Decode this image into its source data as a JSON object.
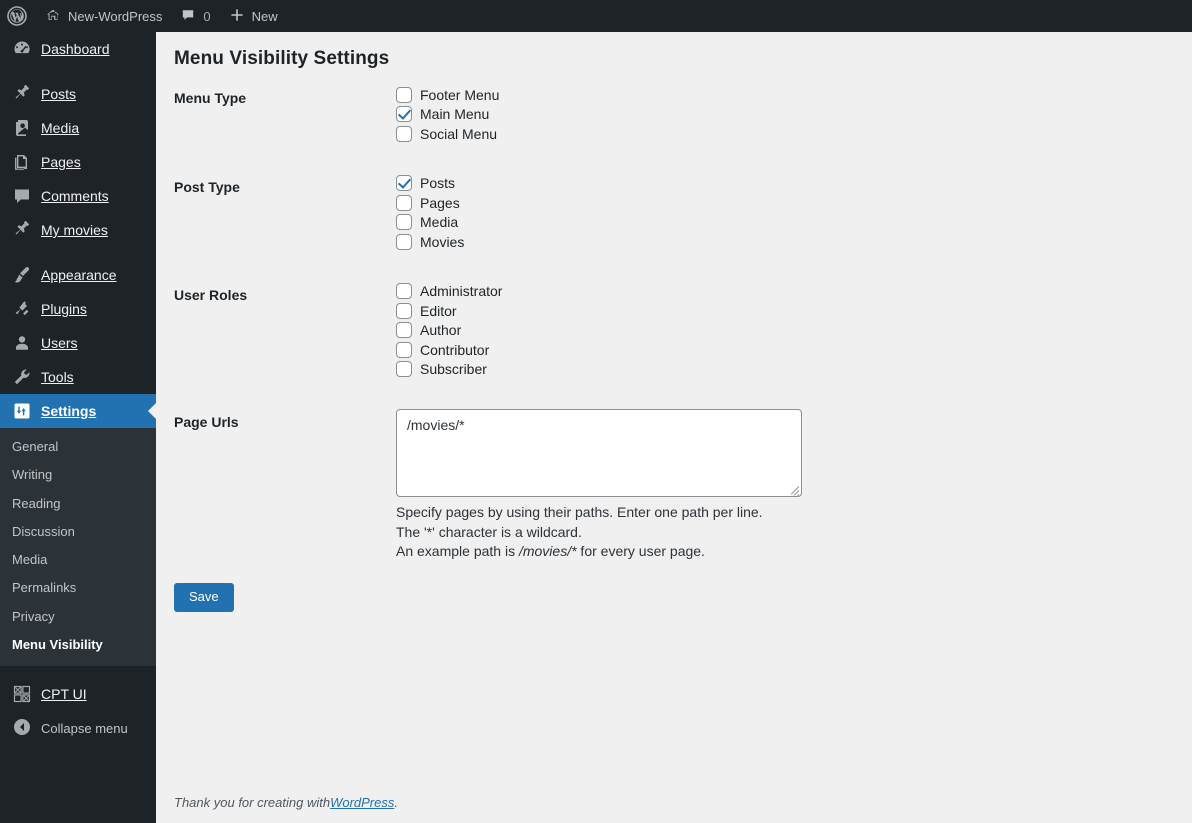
{
  "adminbar": {
    "logo_icon": "wordpress-logo-icon",
    "site": {
      "icon": "home-icon",
      "label": "New-WordPress"
    },
    "comments": {
      "icon": "comment-bubble-icon",
      "count": "0"
    },
    "new": {
      "icon": "plus-icon",
      "label": "New"
    }
  },
  "sidebar": {
    "items": [
      {
        "label": "Dashboard",
        "icon": "dashboard-icon",
        "current": false,
        "separator_before": false
      },
      {
        "label": "Posts",
        "icon": "pin-icon",
        "current": false,
        "separator_before": true
      },
      {
        "label": "Media",
        "icon": "media-icon",
        "current": false,
        "separator_before": false
      },
      {
        "label": "Pages",
        "icon": "pages-icon",
        "current": false,
        "separator_before": false
      },
      {
        "label": "Comments",
        "icon": "comment-bubble-icon",
        "current": false,
        "separator_before": false
      },
      {
        "label": "My movies",
        "icon": "pin-icon",
        "current": false,
        "separator_before": false
      },
      {
        "label": "Appearance",
        "icon": "paintbrush-icon",
        "current": false,
        "separator_before": true
      },
      {
        "label": "Plugins",
        "icon": "plug-icon",
        "current": false,
        "separator_before": false
      },
      {
        "label": "Users",
        "icon": "user-icon",
        "current": false,
        "separator_before": false
      },
      {
        "label": "Tools",
        "icon": "wrench-icon",
        "current": false,
        "separator_before": false
      },
      {
        "label": "Settings",
        "icon": "settings-sliders-icon",
        "current": true,
        "separator_before": false
      }
    ],
    "submenu": [
      {
        "label": "General",
        "current": false
      },
      {
        "label": "Writing",
        "current": false
      },
      {
        "label": "Reading",
        "current": false
      },
      {
        "label": "Discussion",
        "current": false
      },
      {
        "label": "Media",
        "current": false
      },
      {
        "label": "Permalinks",
        "current": false
      },
      {
        "label": "Privacy",
        "current": false
      },
      {
        "label": "Menu Visibility",
        "current": true
      }
    ],
    "after_items": [
      {
        "label": "CPT UI",
        "icon": "cpt-ui-grid-icon",
        "current": false,
        "separator_before": true
      }
    ],
    "collapse": {
      "label": "Collapse menu",
      "icon": "collapse-arrow-icon"
    }
  },
  "page": {
    "title": "Menu Visibility Settings"
  },
  "form": {
    "fields": [
      {
        "label": "Menu Type",
        "name": "menu-type",
        "options": [
          {
            "label": "Footer Menu",
            "checked": false
          },
          {
            "label": "Main Menu",
            "checked": true
          },
          {
            "label": "Social Menu",
            "checked": false
          }
        ]
      },
      {
        "label": "Post Type",
        "name": "post-type",
        "options": [
          {
            "label": "Posts",
            "checked": true
          },
          {
            "label": "Pages",
            "checked": false
          },
          {
            "label": "Media",
            "checked": false
          },
          {
            "label": "Movies",
            "checked": false
          }
        ]
      },
      {
        "label": "User Roles",
        "name": "user-roles",
        "options": [
          {
            "label": "Administrator",
            "checked": false
          },
          {
            "label": "Editor",
            "checked": false
          },
          {
            "label": "Author",
            "checked": false
          },
          {
            "label": "Contributor",
            "checked": false
          },
          {
            "label": "Subscriber",
            "checked": false
          }
        ]
      }
    ],
    "page_urls": {
      "label": "Page Urls",
      "value": "/movies/*",
      "placeholder": "",
      "hint_line1": "Specify pages by using their paths. Enter one path per line.",
      "hint_line2": "The '*' character is a wildcard.",
      "hint_line3_prefix": "An example path is ",
      "hint_line3_example": "/movies/*",
      "hint_line3_suffix": " for every user page."
    },
    "save_label": "Save"
  },
  "footer": {
    "prefix": "Thank you for creating with ",
    "link": "WordPress",
    "suffix": "."
  },
  "colors": {
    "accent": "#2271b1",
    "sidebar_bg": "#1d2327",
    "submenu_bg": "#2c3338",
    "content_bg": "#f0f0f1"
  }
}
